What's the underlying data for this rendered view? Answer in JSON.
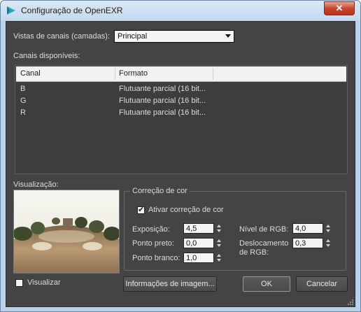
{
  "window": {
    "title": "Configuração de OpenEXR",
    "close": "✕"
  },
  "channel_view": {
    "label": "Vistas de canais (camadas):",
    "selected": "Principal"
  },
  "channels": {
    "label": "Canais disponíveis:",
    "columns": [
      "Canal",
      "Formato"
    ],
    "rows": [
      {
        "canal": "B",
        "formato": "Flutuante parcial (16 bit..."
      },
      {
        "canal": "G",
        "formato": "Flutuante parcial (16 bit..."
      },
      {
        "canal": "R",
        "formato": "Flutuante parcial (16 bit..."
      }
    ]
  },
  "preview": {
    "label": "Visualização:",
    "checkbox_label": "Visualizar",
    "checked": false
  },
  "color_correction": {
    "title": "Correção de cor",
    "enable_label": "Ativar correção de cor",
    "enabled": true,
    "exposure": {
      "label": "Exposição:",
      "value": "4,5"
    },
    "black_point": {
      "label": "Ponto preto:",
      "value": "0,0"
    },
    "white_point": {
      "label": "Ponto branco:",
      "value": "1,0"
    },
    "rgb_level": {
      "label": "Nível de RGB:",
      "value": "4,0"
    },
    "rgb_offset": {
      "label": "Deslocamento de RGB:",
      "value": "0,3"
    }
  },
  "buttons": {
    "image_info": "Informações de imagem...",
    "ok": "OK",
    "cancel": "Cancelar"
  }
}
